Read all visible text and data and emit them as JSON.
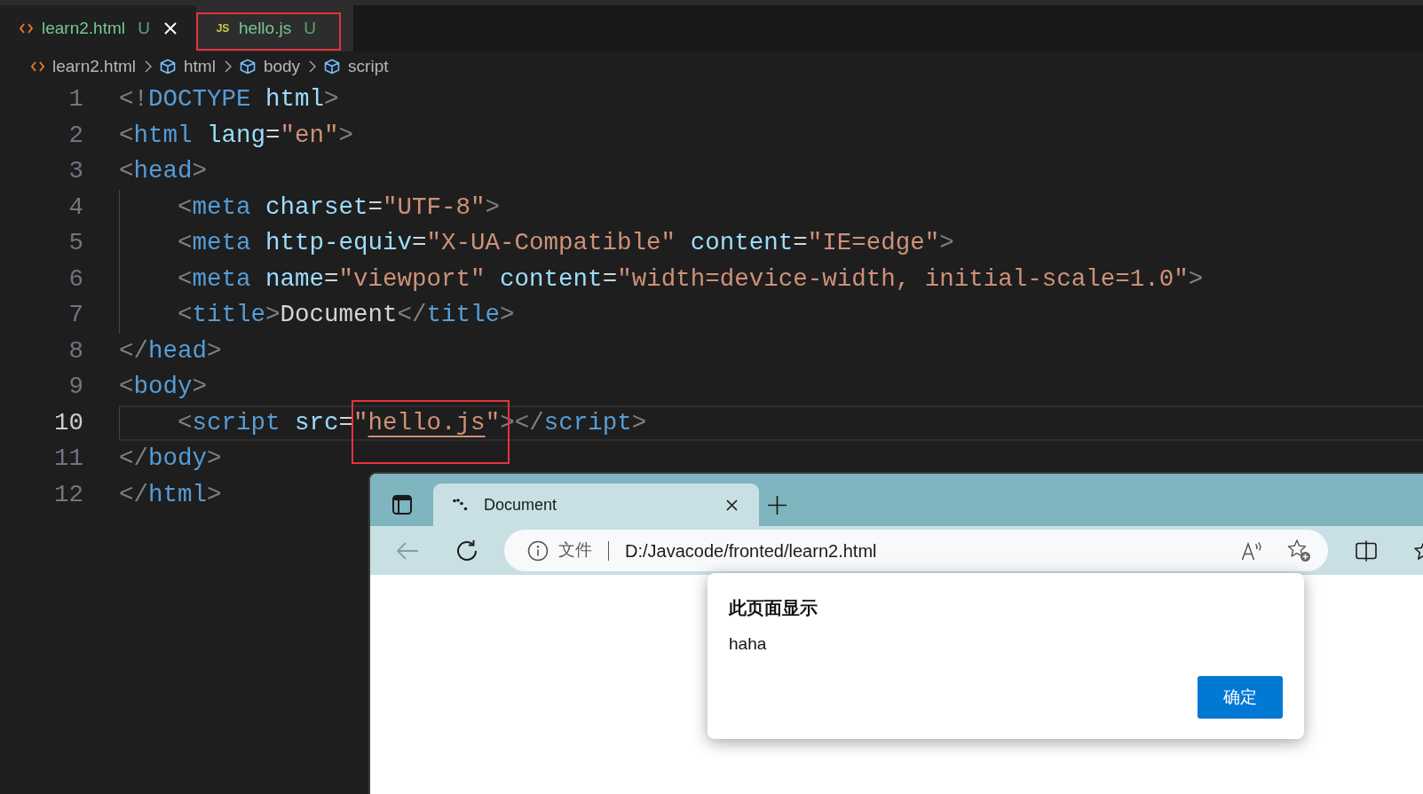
{
  "editor_tabs": [
    {
      "label": "learn2.html",
      "kind": "html",
      "status": "U",
      "selected": true,
      "highlighted": false
    },
    {
      "label": "hello.js",
      "kind": "js",
      "icon_text": "JS",
      "status": "U",
      "selected": false,
      "highlighted": true
    }
  ],
  "breadcrumb": [
    {
      "label": "learn2.html",
      "kind": "file"
    },
    {
      "label": "html",
      "kind": "element"
    },
    {
      "label": "body",
      "kind": "element"
    },
    {
      "label": "script",
      "kind": "element"
    }
  ],
  "code_lines": [
    {
      "number": "1",
      "active": false,
      "indented": false,
      "tokens": [
        {
          "kind": "punct",
          "text": "<!"
        },
        {
          "kind": "tag",
          "text": "DOCTYPE"
        },
        {
          "kind": "attr",
          "text": " html"
        },
        {
          "kind": "punct",
          "text": ">"
        }
      ]
    },
    {
      "number": "2",
      "active": false,
      "indented": false,
      "tokens": [
        {
          "kind": "punct",
          "text": "<"
        },
        {
          "kind": "tag",
          "text": "html"
        },
        {
          "kind": "attr",
          "text": " lang"
        },
        {
          "kind": "text",
          "text": "="
        },
        {
          "kind": "string",
          "text": "\"en\""
        },
        {
          "kind": "punct",
          "text": ">"
        }
      ]
    },
    {
      "number": "3",
      "active": false,
      "indented": false,
      "tokens": [
        {
          "kind": "punct",
          "text": "<"
        },
        {
          "kind": "tag",
          "text": "head"
        },
        {
          "kind": "punct",
          "text": ">"
        }
      ]
    },
    {
      "number": "4",
      "active": false,
      "indented": true,
      "tokens": [
        {
          "kind": "punct",
          "text": "<"
        },
        {
          "kind": "tag",
          "text": "meta"
        },
        {
          "kind": "attr",
          "text": " charset"
        },
        {
          "kind": "text",
          "text": "="
        },
        {
          "kind": "string",
          "text": "\"UTF-8\""
        },
        {
          "kind": "punct",
          "text": ">"
        }
      ]
    },
    {
      "number": "5",
      "active": false,
      "indented": true,
      "tokens": [
        {
          "kind": "punct",
          "text": "<"
        },
        {
          "kind": "tag",
          "text": "meta"
        },
        {
          "kind": "attr",
          "text": " http-equiv"
        },
        {
          "kind": "text",
          "text": "="
        },
        {
          "kind": "string",
          "text": "\"X-UA-Compatible\""
        },
        {
          "kind": "attr",
          "text": " content"
        },
        {
          "kind": "text",
          "text": "="
        },
        {
          "kind": "string",
          "text": "\"IE=edge\""
        },
        {
          "kind": "punct",
          "text": ">"
        }
      ]
    },
    {
      "number": "6",
      "active": false,
      "indented": true,
      "tokens": [
        {
          "kind": "punct",
          "text": "<"
        },
        {
          "kind": "tag",
          "text": "meta"
        },
        {
          "kind": "attr",
          "text": " name"
        },
        {
          "kind": "text",
          "text": "="
        },
        {
          "kind": "string",
          "text": "\"viewport\""
        },
        {
          "kind": "attr",
          "text": " content"
        },
        {
          "kind": "text",
          "text": "="
        },
        {
          "kind": "string",
          "text": "\"width=device-width, initial-scale=1.0\""
        },
        {
          "kind": "punct",
          "text": ">"
        }
      ]
    },
    {
      "number": "7",
      "active": false,
      "indented": true,
      "tokens": [
        {
          "kind": "punct",
          "text": "<"
        },
        {
          "kind": "tag",
          "text": "title"
        },
        {
          "kind": "punct",
          "text": ">"
        },
        {
          "kind": "text",
          "text": "Document"
        },
        {
          "kind": "punct",
          "text": "</"
        },
        {
          "kind": "tag",
          "text": "title"
        },
        {
          "kind": "punct",
          "text": ">"
        }
      ]
    },
    {
      "number": "8",
      "active": false,
      "indented": false,
      "tokens": [
        {
          "kind": "punct",
          "text": "</"
        },
        {
          "kind": "tag",
          "text": "head"
        },
        {
          "kind": "punct",
          "text": ">"
        }
      ]
    },
    {
      "number": "9",
      "active": false,
      "indented": false,
      "tokens": [
        {
          "kind": "punct",
          "text": "<"
        },
        {
          "kind": "tag",
          "text": "body"
        },
        {
          "kind": "punct",
          "text": ">"
        }
      ]
    },
    {
      "number": "10",
      "active": true,
      "indented": true,
      "tokens": [
        {
          "kind": "punct",
          "text": "<"
        },
        {
          "kind": "tag",
          "text": "script"
        },
        {
          "kind": "attr",
          "text": " src"
        },
        {
          "kind": "text",
          "text": "="
        },
        {
          "kind": "group",
          "highlighted": true,
          "tokens": [
            {
              "kind": "string",
              "text": "\""
            },
            {
              "kind": "link",
              "text": "hello.js"
            },
            {
              "kind": "string",
              "text": "\""
            }
          ]
        },
        {
          "kind": "punct",
          "text": "></"
        },
        {
          "kind": "tag",
          "text": "script"
        },
        {
          "kind": "punct",
          "text": ">"
        }
      ]
    },
    {
      "number": "11",
      "active": false,
      "indented": false,
      "tokens": [
        {
          "kind": "punct",
          "text": "</"
        },
        {
          "kind": "tag",
          "text": "body"
        },
        {
          "kind": "punct",
          "text": ">"
        }
      ]
    },
    {
      "number": "12",
      "active": false,
      "indented": false,
      "tokens": [
        {
          "kind": "punct",
          "text": "</"
        },
        {
          "kind": "tag",
          "text": "html"
        },
        {
          "kind": "punct",
          "text": ">"
        }
      ]
    }
  ],
  "browser": {
    "tab": {
      "title": "Document"
    },
    "can_go_back": false,
    "address_bar": {
      "security_label": "文件",
      "url": "D:/Javacode/fronted/learn2.html"
    },
    "dialog": {
      "title": "此页面显示",
      "message": "haha",
      "button": "确定"
    }
  }
}
